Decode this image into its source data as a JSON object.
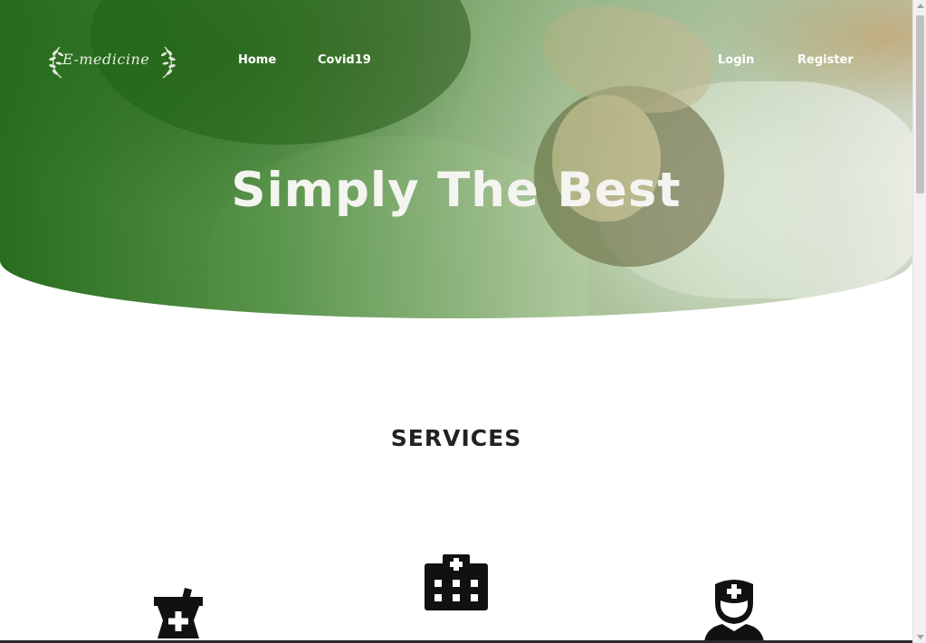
{
  "brand": {
    "logo_text": "E-medicine",
    "logo_icon": "laurel-wreath-icon"
  },
  "nav": {
    "home": "Home",
    "covid": "Covid19",
    "login": "Login",
    "register": "Register"
  },
  "hero": {
    "title": "Simply The Best",
    "overlay_color": "#2a7a1a"
  },
  "services": {
    "title": "SERVICES",
    "icons": [
      "pharmacy-mortar-icon",
      "hospital-icon",
      "doctor-nurse-icon"
    ]
  }
}
